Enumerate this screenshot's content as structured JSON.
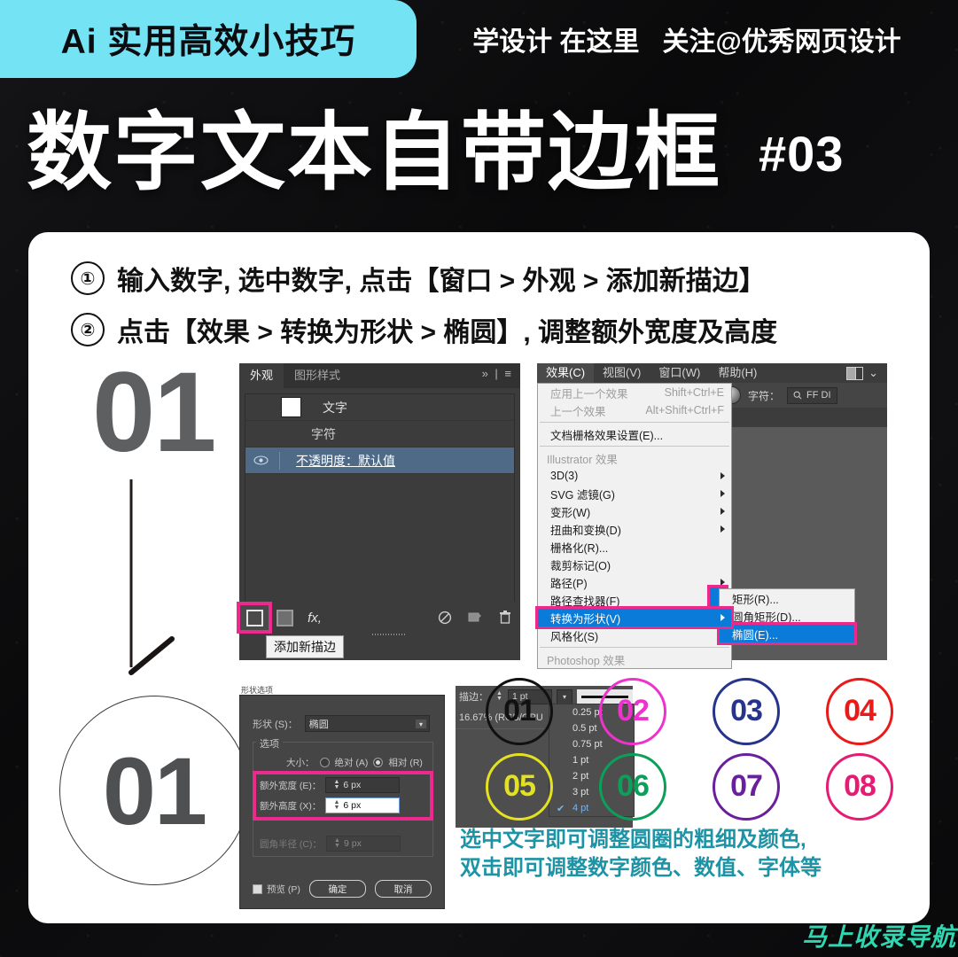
{
  "header": {
    "badge_label": "Ai 实用高效小技巧",
    "tagline_1": "学设计 在这里",
    "tagline_2": "关注@优秀网页设计",
    "title": "数字文本自带边框",
    "issue": "#03",
    "badge_color": "#74e4f5"
  },
  "instructions": [
    {
      "marker": "①",
      "text": "输入数字, 选中数字, 点击【窗口 > 外观 > 添加新描边】"
    },
    {
      "marker": "②",
      "text": "点击【效果 > 转换为形状 > 椭圆】, 调整额外宽度及高度"
    }
  ],
  "left_column": {
    "big_number": "01",
    "circled_number": "01",
    "arrow_icon": "down-arrow-icon"
  },
  "appearance_panel": {
    "tabs": [
      {
        "label": "外观",
        "active": true
      },
      {
        "label": "图形样式",
        "active": false
      }
    ],
    "tab_controls": "» | ≡",
    "rows": [
      {
        "label": "文字",
        "has_swatch": true,
        "selected": false,
        "eye": false
      },
      {
        "label": "字符",
        "has_swatch": false,
        "selected": false,
        "eye": false,
        "indent": true
      },
      {
        "label": "不透明度：默认值",
        "has_swatch": false,
        "selected": true,
        "eye": true
      }
    ],
    "toolbar_icons": [
      "add-new-stroke-icon",
      "add-new-fill-icon",
      "add-new-effect-icon",
      "clear-appearance-icon",
      "duplicate-item-icon",
      "delete-item-icon"
    ],
    "effect_glyph": "fx,",
    "tooltip": "添加新描边",
    "highlight_color": "#ec2a8e"
  },
  "ai_menubar": {
    "items": [
      "效果(C)",
      "视图(V)",
      "窗口(W)",
      "帮助(H)"
    ],
    "active_index": 0,
    "layout_icon": "workspace-layout-icon",
    "chevron": "⌄"
  },
  "ai_controlbar": {
    "globe_icon": "appearance-globe-icon",
    "label": "字符：",
    "search_icon": "search-icon",
    "font_value": "FF DI"
  },
  "effects_menu": {
    "items": [
      {
        "label": "应用上一个效果",
        "shortcut": "Shift+Ctrl+E",
        "dim": true
      },
      {
        "label": "上一个效果",
        "shortcut": "Alt+Shift+Ctrl+F",
        "dim": true
      },
      {
        "sep": true
      },
      {
        "label": "文档栅格效果设置(E)...",
        "shortcut": "",
        "dim": false
      },
      {
        "sep": true
      },
      {
        "label": "Illustrator 效果",
        "shortcut": "",
        "dim": true,
        "section": true
      },
      {
        "label": "3D(3)",
        "shortcut": "",
        "dim": false,
        "arrow": true
      },
      {
        "label": "SVG 滤镜(G)",
        "shortcut": "",
        "dim": false,
        "arrow": true
      },
      {
        "label": "变形(W)",
        "shortcut": "",
        "dim": false,
        "arrow": true
      },
      {
        "label": "扭曲和变换(D)",
        "shortcut": "",
        "dim": false,
        "arrow": true
      },
      {
        "label": "栅格化(R)...",
        "shortcut": "",
        "dim": false
      },
      {
        "label": "裁剪标记(O)",
        "shortcut": "",
        "dim": false
      },
      {
        "label": "路径(P)",
        "shortcut": "",
        "dim": false,
        "arrow": true
      },
      {
        "label": "路径查找器(F)",
        "shortcut": "",
        "dim": false,
        "arrow": true
      },
      {
        "label": "转换为形状(V)",
        "shortcut": "",
        "dim": false,
        "arrow": true,
        "highlight": true
      },
      {
        "label": "风格化(S)",
        "shortcut": "",
        "dim": false,
        "arrow": true
      },
      {
        "sep": true
      },
      {
        "label": "Photoshop 效果",
        "shortcut": "",
        "dim": true,
        "section": true
      }
    ]
  },
  "shape_submenu": {
    "items": [
      {
        "label": "矩形(R)...",
        "highlight": false
      },
      {
        "label": "圆角矩形(D)...",
        "highlight": false
      },
      {
        "label": "椭圆(E)...",
        "highlight": true
      }
    ]
  },
  "shape_dialog": {
    "title": "形状选项",
    "shape_label": "形状 (S)：",
    "shape_value": "椭圆",
    "group_label": "选项",
    "size_label": "大小：",
    "size_absolute": "绝对 (A)",
    "size_relative": "相对 (R)",
    "size_selected": "relative",
    "extra_width_label": "额外宽度 (E)：",
    "extra_width_value": "6 px",
    "extra_height_label": "额外高度 (X)：",
    "extra_height_value": "6 px",
    "corner_radius_label": "圆角半径 (C)：",
    "corner_radius_value": "9 px",
    "preview_label": "预览 (P)",
    "ok_label": "确定",
    "cancel_label": "取消"
  },
  "stroke_panel": {
    "label": "描边：",
    "value": "1 pt",
    "caret_icon": "chevron-down-icon",
    "zoom_status": "16.67% (RGB/GPU",
    "options": [
      "0.25 pt",
      "0.5 pt",
      "0.75 pt",
      "1 pt",
      "2 pt",
      "3 pt",
      "4 pt"
    ],
    "selected_option": "4 pt",
    "check_icon": "check-icon"
  },
  "number_circles": [
    {
      "label": "01",
      "color": "#111111"
    },
    {
      "label": "02",
      "color": "#ee33cc"
    },
    {
      "label": "03",
      "color": "#26348c"
    },
    {
      "label": "04",
      "color": "#ea1a1a"
    },
    {
      "label": "05",
      "color": "#e3e222"
    },
    {
      "label": "06",
      "color": "#0aa05a"
    },
    {
      "label": "07",
      "color": "#6a1f9e"
    },
    {
      "label": "08",
      "color": "#e51b74"
    }
  ],
  "caption": {
    "line1": "选中文字即可调整圆圈的粗细及颜色,",
    "line2": "双击即可调整数字颜色、数值、字体等",
    "color": "#1d94a6"
  },
  "watermark": {
    "text": "马上收录导航",
    "color": "#2fd6b0"
  }
}
